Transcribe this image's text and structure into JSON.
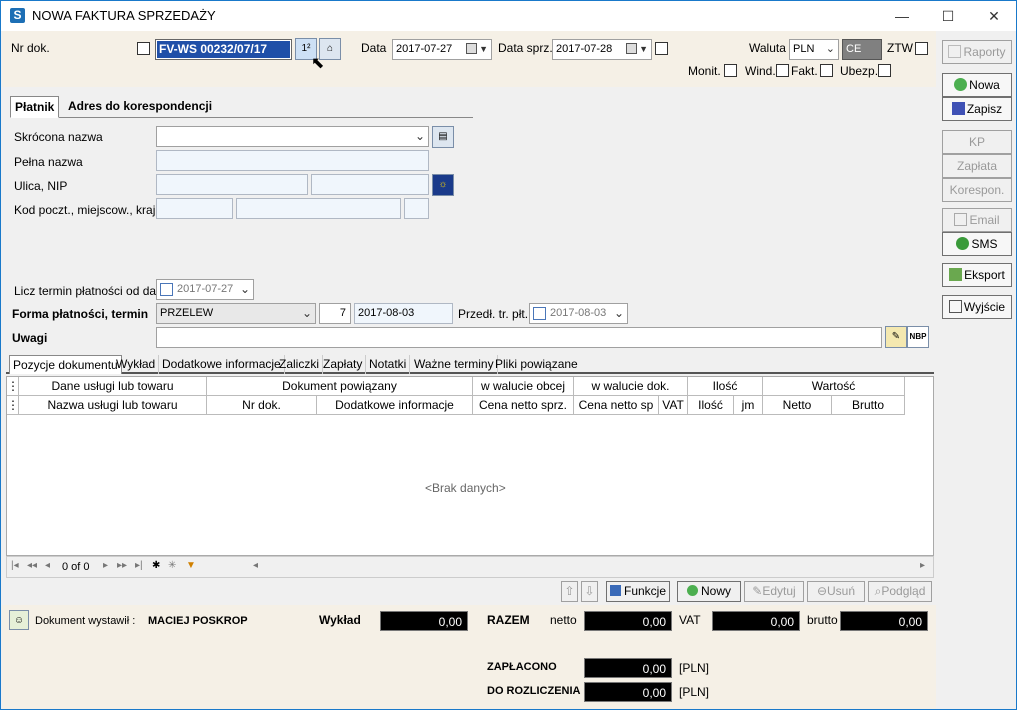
{
  "window": {
    "title": "NOWA FAKTURA SPRZEDAŻY",
    "minimize": "—",
    "maximize": "☐",
    "close": "✕"
  },
  "header": {
    "nr_dok_label": "Nr dok.",
    "nr_dok_value": "FV-WS 00232/07/17",
    "data_label": "Data",
    "data_value": "2017-07-27",
    "data_sprz_label": "Data sprz.",
    "data_sprz_value": "2017-07-28",
    "waluta_label": "Waluta",
    "waluta_value": "PLN",
    "ce_value": "CE",
    "ztw_label": "ZTW",
    "monit_label": "Monit.",
    "wind_label": "Wind.",
    "fakt_label": "Fakt.",
    "ubezp_label": "Ubezp."
  },
  "payer_tabs": [
    "Płatnik",
    "Adres do korespondencji"
  ],
  "payer": {
    "skrocona_label": "Skrócona nazwa",
    "pelna_label": "Pełna nazwa",
    "ulica_label": "Ulica, NIP",
    "kod_label": "Kod poczt., miejscow., kraj",
    "licz_label": "Licz termin płatności od daty",
    "licz_value": "2017-07-27",
    "forma_label": "Forma płatności, termin",
    "forma_value": "PRZELEW",
    "termin_days": "7",
    "termin_date": "2017-08-03",
    "predl_label": "Przedł. tr. płt.",
    "predl_value": "2017-08-03",
    "uwagi_label": "Uwagi",
    "nbp_label": "NBP"
  },
  "sidebar": {
    "raporty": "Raporty",
    "nowa": "Nowa",
    "zapisz": "Zapisz",
    "kp": "KP",
    "zaplata": "Zapłata",
    "korespon": "Korespon.",
    "email": "Email",
    "sms": "SMS",
    "eksport": "Eksport",
    "wyjscie": "Wyjście"
  },
  "doc_tabs": [
    "Pozycje dokumentu",
    "Wykład",
    "Dodatkowe informacje",
    "Zaliczki",
    "Zapłaty",
    "Notatki",
    "Ważne terminy",
    "Pliki powiązane"
  ],
  "grid": {
    "group_headers": [
      "Dane usługi lub towaru",
      "Dokument powiązany",
      "w walucie obcej",
      "w walucie dok.",
      "Ilość",
      "Wartość"
    ],
    "columns": [
      "Nazwa usługi lub towaru",
      "Nr dok.",
      "Dodatkowe informacje",
      "Cena netto sprz.",
      "Cena netto sp",
      "VAT",
      "Ilość",
      "jm",
      "Netto",
      "Brutto"
    ],
    "empty": "<Brak danych>",
    "record_counter": "0 of 0"
  },
  "toolbar": {
    "funkcje": "Funkcje",
    "nowy": "Nowy",
    "edytuj": "Edytuj",
    "usun": "Usuń",
    "podglad": "Podgląd"
  },
  "footer": {
    "wystawil_label": "Dokument wystawił :",
    "wystawil_value": "MACIEJ POSKROP",
    "wyklad_label": "Wykład",
    "wyklad_value": "0,00",
    "razem_label": "RAZEM",
    "netto_label": "netto",
    "netto_value": "0,00",
    "vat_label": "VAT",
    "vat_value": "0,00",
    "brutto_label": "brutto",
    "brutto_value": "0,00",
    "zaplacono_label": "ZAPŁACONO",
    "zaplacono_value": "0,00",
    "zaplacono_cur": "[PLN]",
    "rozlicz_label": "DO ROZLICZENIA",
    "rozlicz_value": "0,00",
    "rozlicz_cur": "[PLN]"
  },
  "colors": {
    "accent": "#1979ca",
    "form_bg": "#f5f0e6",
    "selection": "#1f4fa8"
  }
}
